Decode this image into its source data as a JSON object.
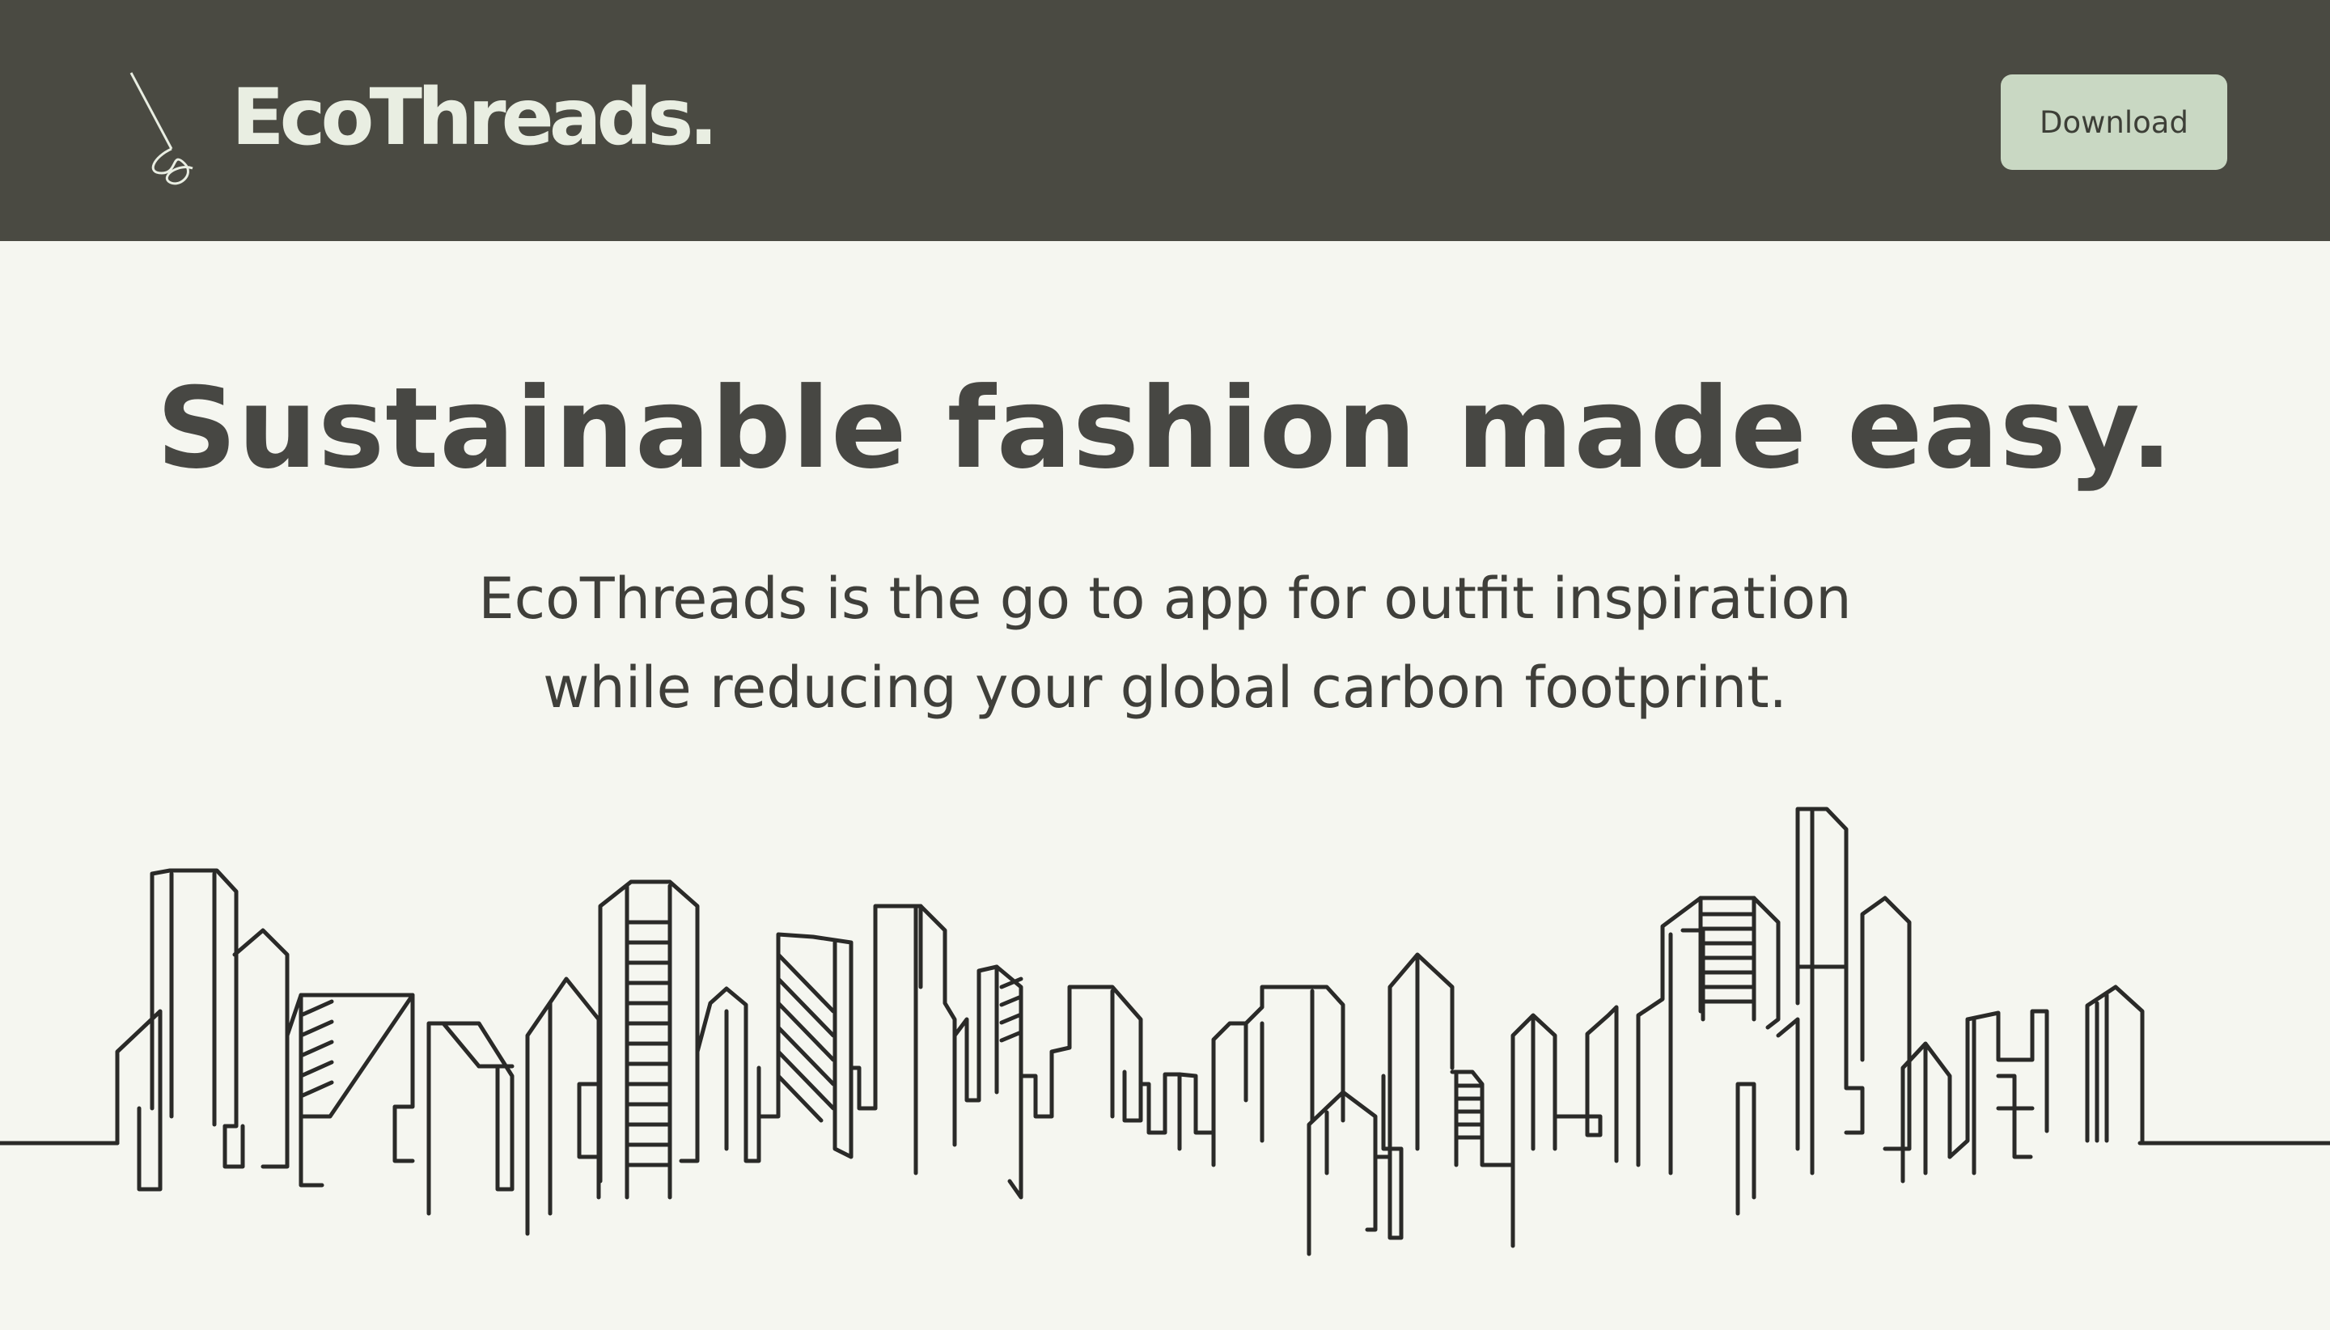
{
  "header": {
    "logo_text": "EcoThreads.",
    "logo_icon": "needle-thread-icon",
    "download_label": "Download"
  },
  "hero": {
    "title": "Sustainable fashion made easy.",
    "subtitle_line1": "EcoThreads is the go to app for outfit inspiration",
    "subtitle_line2": "while reducing your global carbon footprint."
  },
  "illustration": {
    "name": "city-skyline-line-art"
  },
  "colors": {
    "header_bg": "#4a4a42",
    "page_bg": "#f5f6f0",
    "button_bg": "#c9d8c3",
    "logo_text": "#e9eee2",
    "title_text": "#474743"
  }
}
